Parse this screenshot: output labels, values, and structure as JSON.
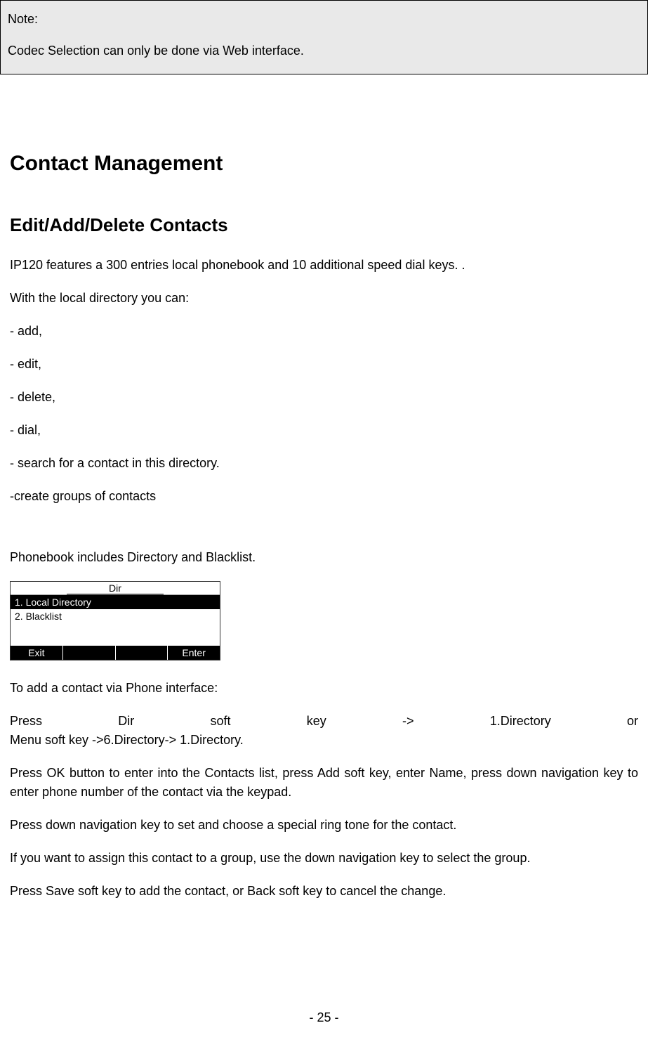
{
  "note": {
    "title": "Note:",
    "body": "Codec Selection can only be done via Web interface."
  },
  "h1": "Contact Management",
  "h2": "Edit/Add/Delete Contacts",
  "paragraphs": {
    "p1": "IP120 features a 300 entries local phonebook and 10 additional speed dial keys. .",
    "p2": "With the local directory you can:",
    "p3": "- add,",
    "p4": "- edit,",
    "p5": "- delete,",
    "p6": "- dial,",
    "p7": "- search for a contact in this directory.",
    "p8": "-create groups of contacts",
    "p9": "Phonebook includes Directory and Blacklist.",
    "p10": "To add a contact via Phone interface:",
    "p11_line1": "Press Dir soft key -> 1.Directory or",
    "p11_line2": "Menu soft key ->6.Directory-> 1.Directory.",
    "p12": "Press OK button to enter into the Contacts list, press Add soft key, enter Name, press down navigation key to enter phone number of the contact via the keypad.",
    "p13": "Press down navigation key to set and choose a special ring tone for the contact.",
    "p14": "If you want to assign this contact to a group, use the down navigation key to select the group.",
    "p15": "Press Save soft key to add the contact, or Back soft key to cancel the change."
  },
  "phone_screen": {
    "title": "Dir",
    "row1": "1. Local Directory",
    "row2": "2. Blacklist",
    "softkeys": {
      "left": "Exit",
      "mid1": "",
      "mid2": "",
      "right": "Enter"
    }
  },
  "page_number": "- 25 -"
}
